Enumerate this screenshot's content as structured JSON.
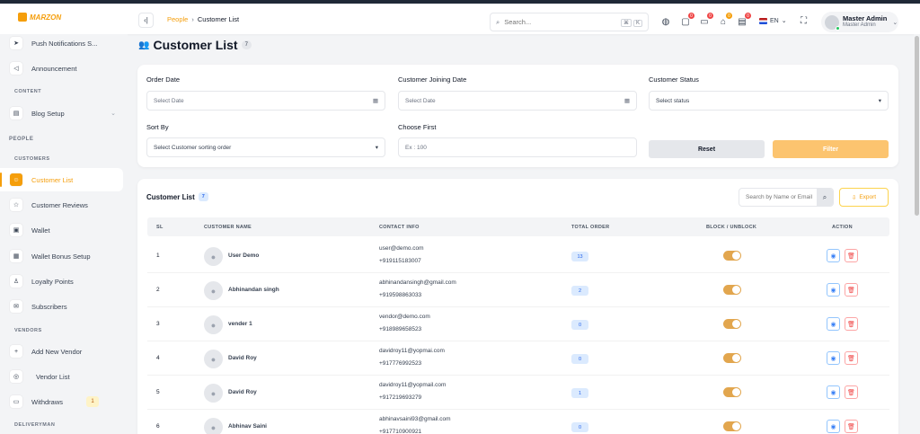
{
  "app": {
    "logo_text": "MARZON",
    "brand_color": "#f59e0b"
  },
  "header": {
    "breadcrumb": {
      "parent": "People",
      "separator": "›",
      "current": "Customer List"
    },
    "search": {
      "placeholder": "Search...",
      "shortcut_key1": "⌘",
      "shortcut_key2": "K"
    },
    "icons": [
      {
        "name": "globe-icon",
        "badge": ""
      },
      {
        "name": "shopping-bag-icon",
        "badge": "0"
      },
      {
        "name": "message-icon",
        "badge": "0"
      },
      {
        "name": "bank-icon",
        "badge": "0"
      },
      {
        "name": "card-icon",
        "badge": "0"
      }
    ],
    "language": "EN",
    "user": {
      "name": "Master Admin",
      "role": "Master Admin"
    }
  },
  "sidebar": {
    "items": [
      {
        "label": "Push Notifications S...",
        "icon": "send-icon"
      },
      {
        "label": "Announcement",
        "icon": "megaphone-icon"
      },
      {
        "label": "Blog Setup",
        "icon": "document-icon"
      },
      {
        "label": "Customer List",
        "icon": "users-icon"
      },
      {
        "label": "Customer Reviews",
        "icon": "star-icon"
      },
      {
        "label": "Wallet",
        "icon": "wallet-icon"
      },
      {
        "label": "Wallet Bonus Setup",
        "icon": "gift-icon"
      },
      {
        "label": "Loyalty Points",
        "icon": "trophy-icon"
      },
      {
        "label": "Subscribers",
        "icon": "mail-icon"
      },
      {
        "label": "Add New Vendor",
        "icon": "user-plus-icon"
      },
      {
        "label": "Vendor List",
        "icon": "list-icon"
      },
      {
        "label": "Withdraws",
        "icon": "withdraw-icon",
        "count": "1"
      }
    ],
    "headings": {
      "content": "CONTENT",
      "people": "PEOPLE",
      "customers": "CUSTOMERS",
      "vendors": "VENDORS",
      "deliveryman": "DELIVERYMAN"
    }
  },
  "page": {
    "title": "Customer List",
    "count": "7"
  },
  "filters": {
    "order_date": {
      "label": "Order Date",
      "placeholder": "Select Date"
    },
    "joining_date": {
      "label": "Customer Joining Date",
      "placeholder": "Select Date"
    },
    "status": {
      "label": "Customer Status",
      "value": "Select status"
    },
    "sort_by": {
      "label": "Sort By",
      "value": "Select Customer sorting order"
    },
    "choose_first": {
      "label": "Choose First",
      "placeholder": "Ex : 100"
    },
    "reset_label": "Reset",
    "filter_label": "Filter"
  },
  "table": {
    "title": "Customer List",
    "count": "7",
    "search_placeholder": "Search by Name or Email",
    "export_label": "Export",
    "columns": [
      "SL",
      "CUSTOMER NAME",
      "CONTACT INFO",
      "TOTAL ORDER",
      "BLOCK / UNBLOCK",
      "ACTION"
    ],
    "rows": [
      {
        "sl": "1",
        "name": "User Demo",
        "email": "user@demo.com",
        "phone": "+919115183007",
        "orders": "13",
        "active": true
      },
      {
        "sl": "2",
        "name": "Abhinandan singh",
        "email": "abhinandansingh@gmail.com",
        "phone": "+919598863033",
        "orders": "2",
        "active": true
      },
      {
        "sl": "3",
        "name": "vender 1",
        "email": "vendor@demo.com",
        "phone": "+918989658523",
        "orders": "0",
        "active": true
      },
      {
        "sl": "4",
        "name": "David Roy",
        "email": "davidroy11@yopmai.com",
        "phone": "+917776992523",
        "orders": "0",
        "active": true
      },
      {
        "sl": "5",
        "name": "David Roy",
        "email": "davidroy11@yopmail.com",
        "phone": "+917219693279",
        "orders": "1",
        "active": true
      },
      {
        "sl": "6",
        "name": "Abhinav Saini",
        "email": "abhinavsaini93@gmail.com",
        "phone": "+917710900921",
        "orders": "0",
        "active": true
      }
    ]
  }
}
